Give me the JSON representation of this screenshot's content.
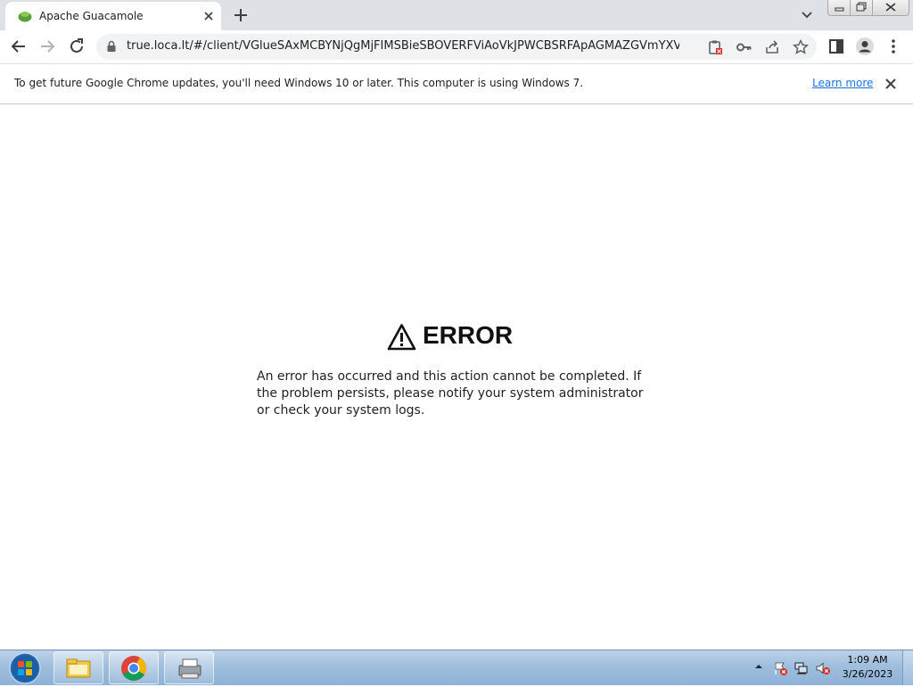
{
  "browser": {
    "tab": {
      "title": "Apache Guacamole",
      "favicon": "guacamole-icon"
    },
    "url": "true.loca.lt/#/client/VGlueSAxMCBYNjQgMjFIMSBieSBOVERFViAoVkJPWCBSRFApAGMAZGVmYXVsdA"
  },
  "infobar": {
    "message": "To get future Google Chrome updates, you'll need Windows 10 or later. This computer is using Windows 7.",
    "link_label": "Learn more"
  },
  "page": {
    "error_title": "ERROR",
    "error_message": "An error has occurred and this action cannot be completed. If the problem persists, please notify your system administrator or check your system logs."
  },
  "taskbar": {
    "apps": [
      "file-explorer-icon",
      "chrome-icon",
      "printer-icon"
    ],
    "time": "1:09 AM",
    "date": "3/26/2023"
  },
  "colors": {
    "accent": "#1a73e8",
    "tabstrip": "#dee1e6",
    "taskbar": "#9fbedd"
  }
}
